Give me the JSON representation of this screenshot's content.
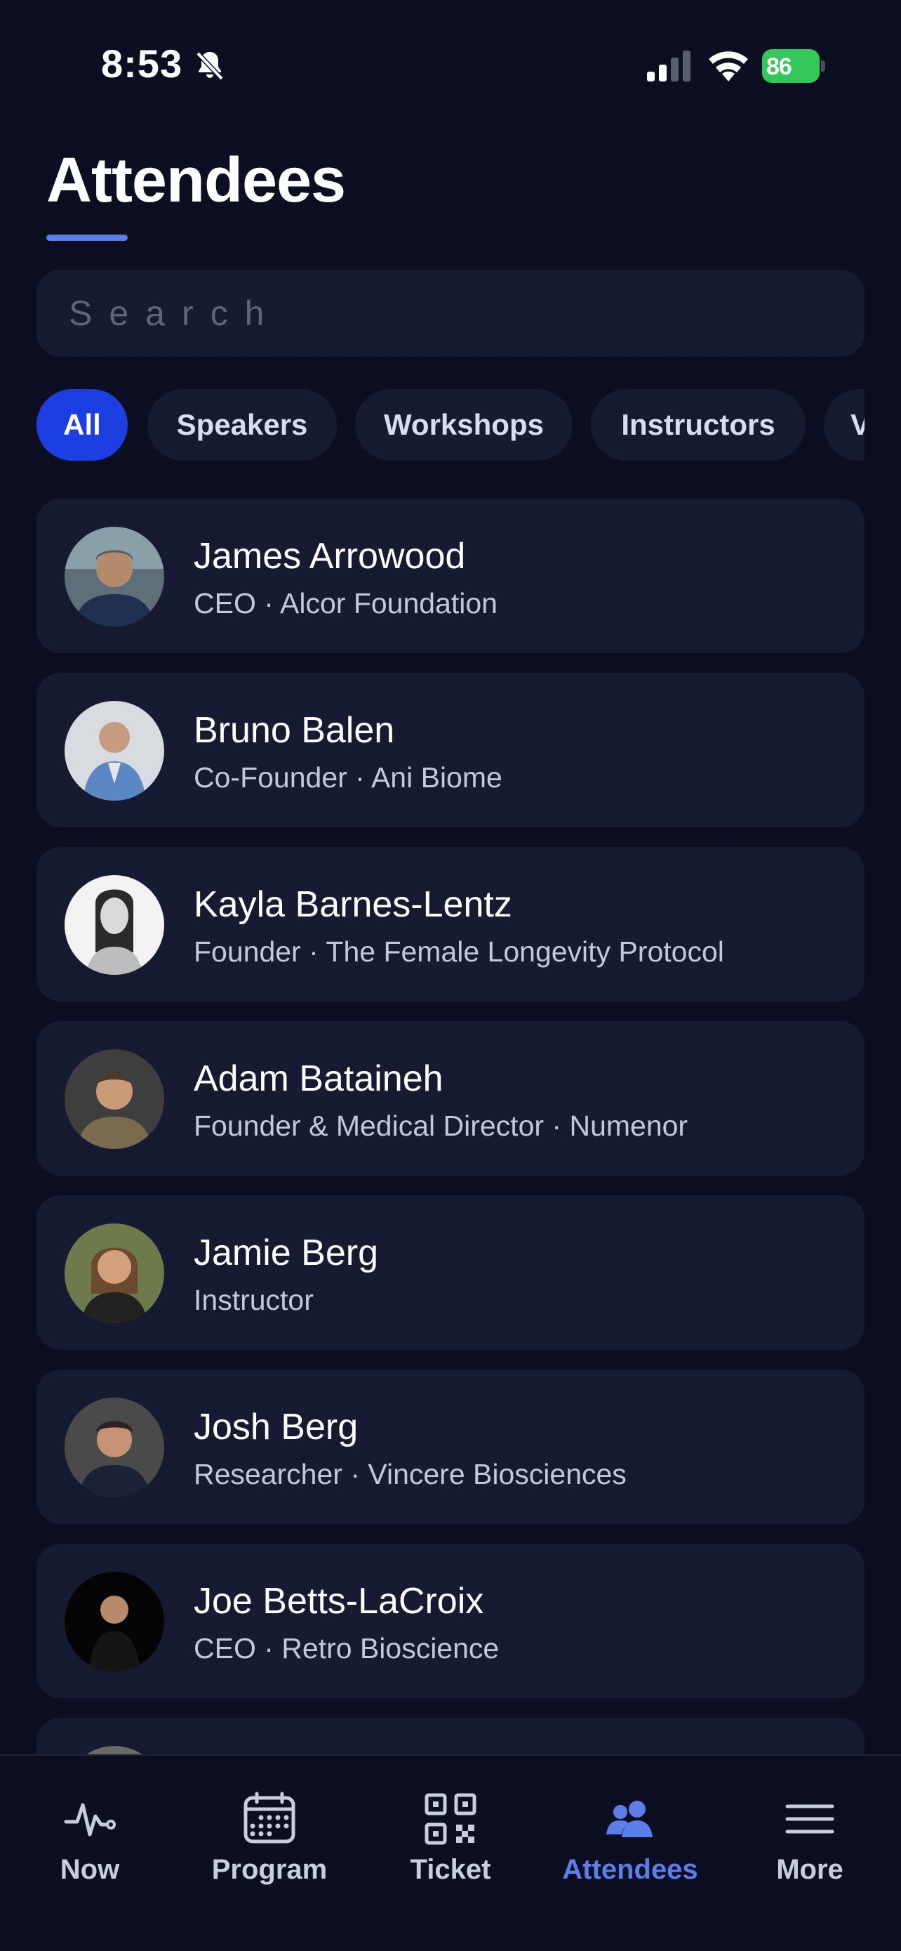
{
  "status_bar": {
    "time": "8:53",
    "battery": "86"
  },
  "header": {
    "title": "Attendees"
  },
  "search": {
    "placeholder": "Search"
  },
  "filters": [
    {
      "label": "All",
      "active": true
    },
    {
      "label": "Speakers",
      "active": false
    },
    {
      "label": "Workshops",
      "active": false
    },
    {
      "label": "Instructors",
      "active": false
    },
    {
      "label": "V",
      "active": false
    }
  ],
  "attendees": [
    {
      "name": "James Arrowood",
      "role": "CEO · Alcor Foundation"
    },
    {
      "name": "Bruno Balen",
      "role": "Co-Founder · Ani Biome"
    },
    {
      "name": "Kayla Barnes-Lentz",
      "role": "Founder · The Female Longevity Protocol"
    },
    {
      "name": "Adam Bataineh",
      "role": "Founder & Medical Director · Numenor"
    },
    {
      "name": "Jamie Berg",
      "role": "Instructor"
    },
    {
      "name": "Josh Berg",
      "role": "Researcher · Vincere Biosciences"
    },
    {
      "name": "Joe Betts-LaCroix",
      "role": "CEO · Retro Bioscience"
    }
  ],
  "tabs": [
    {
      "label": "Now",
      "icon": "pulse-icon",
      "active": false
    },
    {
      "label": "Program",
      "icon": "calendar-icon",
      "active": false
    },
    {
      "label": "Ticket",
      "icon": "qr-code-icon",
      "active": false
    },
    {
      "label": "Attendees",
      "icon": "people-icon",
      "active": true
    },
    {
      "label": "More",
      "icon": "menu-icon",
      "active": false
    }
  ],
  "colors": {
    "accent": "#5b7ee8",
    "active_chip": "#1d3ee0",
    "background": "#0b0f21",
    "card": "#171b32",
    "battery": "#34c759"
  }
}
